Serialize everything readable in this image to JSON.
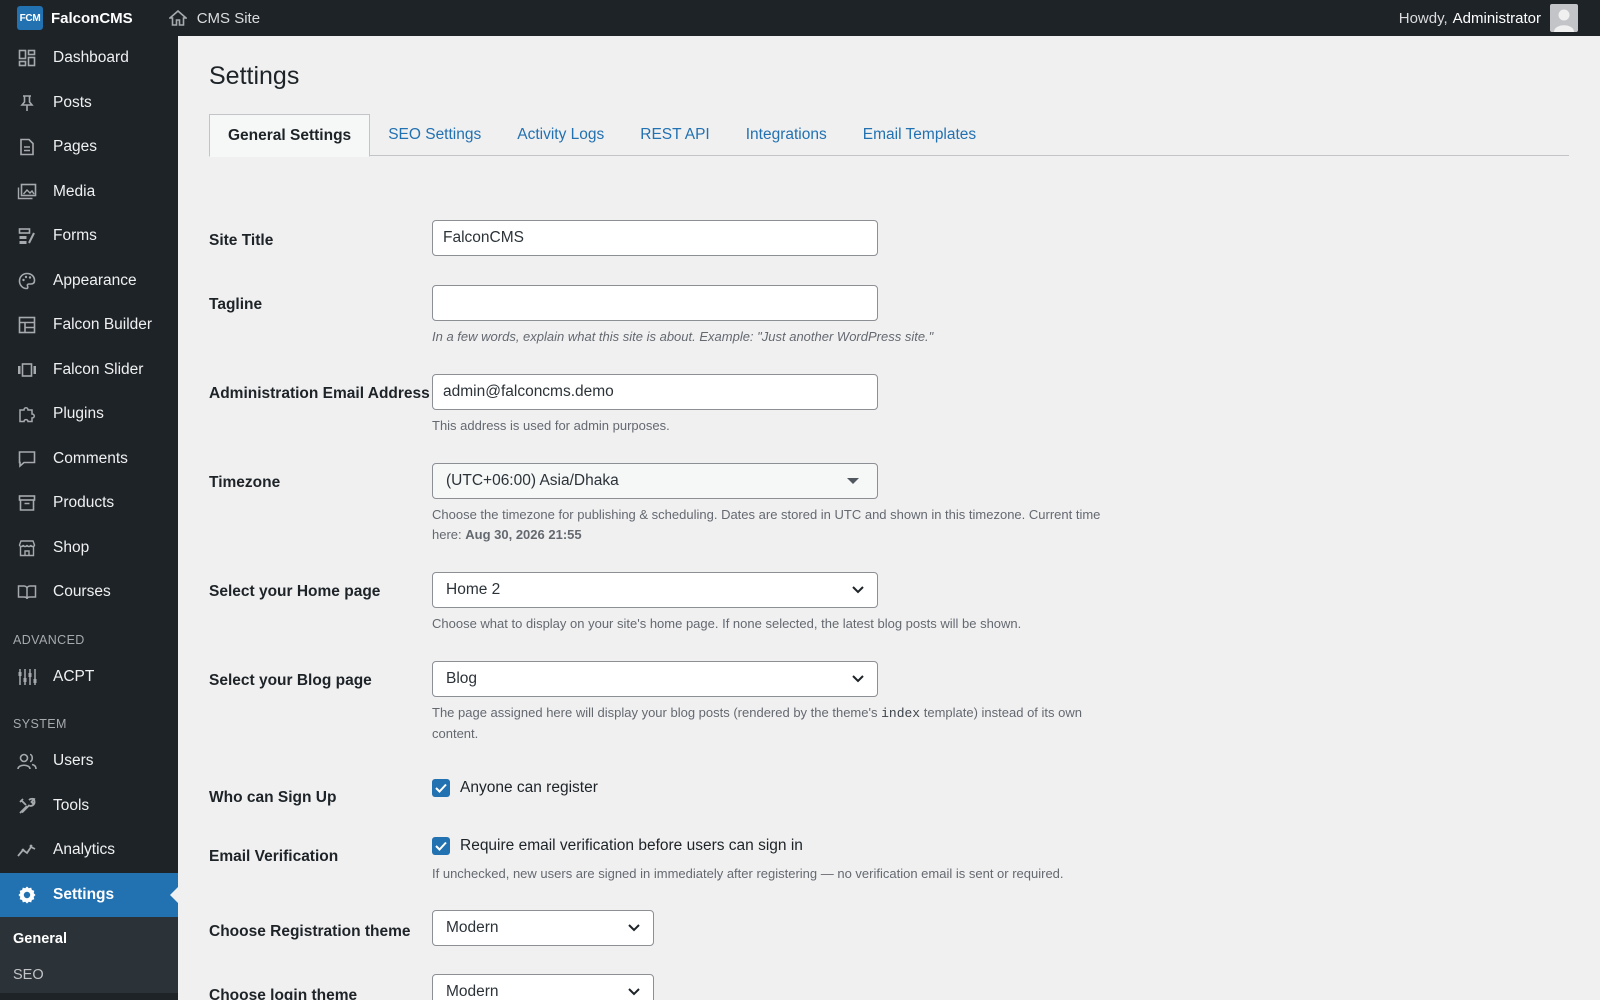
{
  "topbar": {
    "logo_text": "FCM",
    "brand": "FalconCMS",
    "site_link": "CMS Site",
    "howdy": "Howdy,",
    "user": "Administrator"
  },
  "sidebar": {
    "items": [
      {
        "label": "Dashboard",
        "icon": "dashboard-icon"
      },
      {
        "label": "Posts",
        "icon": "pin-icon"
      },
      {
        "label": "Pages",
        "icon": "page-icon"
      },
      {
        "label": "Media",
        "icon": "media-icon"
      },
      {
        "label": "Forms",
        "icon": "forms-icon"
      },
      {
        "label": "Appearance",
        "icon": "palette-icon"
      },
      {
        "label": "Falcon Builder",
        "icon": "builder-icon"
      },
      {
        "label": "Falcon Slider",
        "icon": "slider-icon"
      },
      {
        "label": "Plugins",
        "icon": "plugin-icon"
      },
      {
        "label": "Comments",
        "icon": "comment-icon"
      },
      {
        "label": "Products",
        "icon": "archive-icon"
      },
      {
        "label": "Shop",
        "icon": "store-icon"
      },
      {
        "label": "Courses",
        "icon": "book-icon"
      }
    ],
    "section_advanced": "ADVANCED",
    "advanced_items": [
      {
        "label": "ACPT",
        "icon": "sliders-icon"
      }
    ],
    "section_system": "SYSTEM",
    "system_items": [
      {
        "label": "Users",
        "icon": "users-icon"
      },
      {
        "label": "Tools",
        "icon": "tools-icon"
      },
      {
        "label": "Analytics",
        "icon": "analytics-icon"
      }
    ],
    "active_item": {
      "label": "Settings",
      "icon": "gear-icon"
    },
    "submenu": [
      {
        "label": "General"
      },
      {
        "label": "SEO"
      }
    ]
  },
  "page": {
    "title": "Settings",
    "tabs": [
      {
        "label": "General Settings",
        "active": true
      },
      {
        "label": "SEO Settings"
      },
      {
        "label": "Activity Logs"
      },
      {
        "label": "REST API"
      },
      {
        "label": "Integrations"
      },
      {
        "label": "Email Templates"
      }
    ]
  },
  "form": {
    "site_title": {
      "label": "Site Title",
      "value": "FalconCMS"
    },
    "tagline": {
      "label": "Tagline",
      "value": "",
      "description": "In a few words, explain what this site is about. Example: \"Just another WordPress site.\""
    },
    "admin_email": {
      "label": "Administration Email Address",
      "value": "admin@falconcms.demo",
      "description": "This address is used for admin purposes."
    },
    "timezone": {
      "label": "Timezone",
      "value": "(UTC+06:00) Asia/Dhaka",
      "description": "Choose the timezone for publishing & scheduling. Dates are stored in UTC and shown in this timezone. Current time here:",
      "current_time": "Aug 30, 2026 21:55"
    },
    "home_page": {
      "label": "Select your Home page",
      "value": "Home 2",
      "description": "Choose what to display on your site's home page. If none selected, the latest blog posts will be shown."
    },
    "blog_page": {
      "label": "Select your Blog page",
      "value": "Blog",
      "description_before": "The page assigned here will display your blog posts (rendered by the theme's",
      "description_code": "index",
      "description_after": "template) instead of its own content."
    },
    "signup": {
      "label": "Who can Sign Up",
      "checkbox_label": "Anyone can register",
      "checked": true
    },
    "email_verification": {
      "label": "Email Verification",
      "checkbox_label": "Require email verification before users can sign in",
      "checked": true,
      "description": "If unchecked, new users are signed in immediately after registering — no verification email is sent or required."
    },
    "registration_theme": {
      "label": "Choose Registration theme",
      "value": "Modern"
    },
    "login_theme": {
      "label": "Choose login theme",
      "value": "Modern"
    }
  },
  "colors": {
    "accent": "#2271b1",
    "sidebar_bg": "#1d2327",
    "page_bg": "#f0f0f1"
  }
}
